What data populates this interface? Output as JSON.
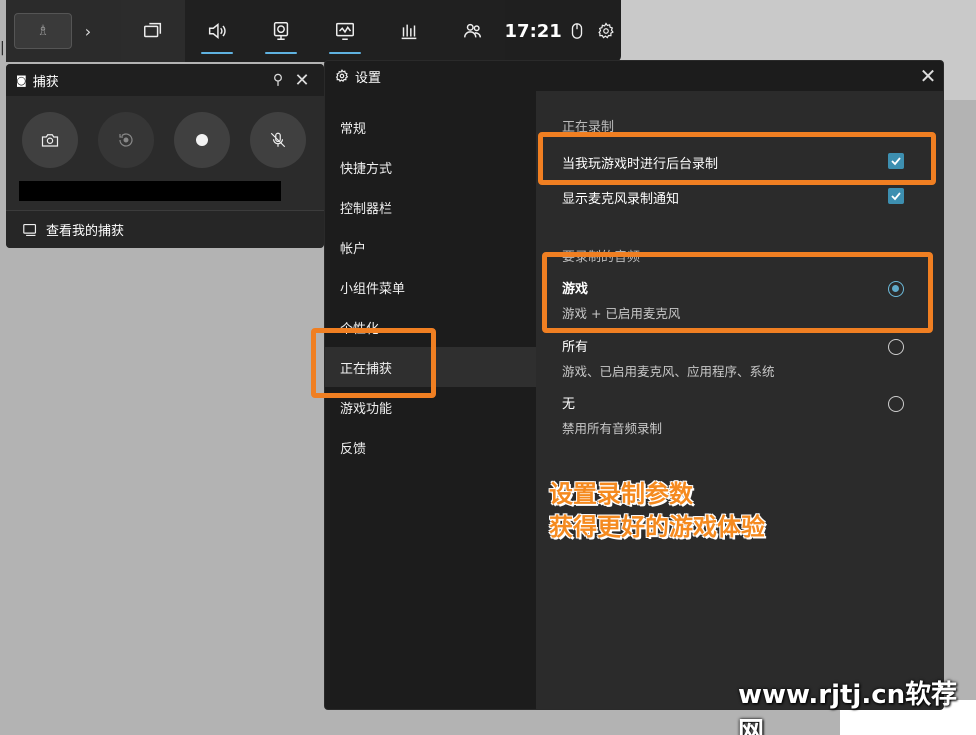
{
  "topbar": {
    "time": "17:21",
    "icons": [
      "widget-menu-icon",
      "audio-icon",
      "capture-icon",
      "performance-icon",
      "resources-icon",
      "xbox-social-icon"
    ]
  },
  "capture_widget": {
    "title": "捕获",
    "view_captures": "查看我的捕获"
  },
  "settings": {
    "title": "设置",
    "nav": [
      {
        "label": "常规"
      },
      {
        "label": "快捷方式"
      },
      {
        "label": "控制器栏"
      },
      {
        "label": "帐户"
      },
      {
        "label": "小组件菜单"
      },
      {
        "label": "个性化"
      },
      {
        "label": "正在捕获"
      },
      {
        "label": "游戏功能"
      },
      {
        "label": "反馈"
      }
    ],
    "recording_section": "正在录制",
    "bg_record": "当我玩游戏时进行后台录制",
    "mic_notify": "显示麦克风录制通知",
    "audio_section": "要录制的音频",
    "audio_options": [
      {
        "label": "游戏",
        "sub": "游戏 + 已启用麦克风",
        "selected": true
      },
      {
        "label": "所有",
        "sub": "游戏、已启用麦克风、应用程序、系统",
        "selected": false
      },
      {
        "label": "无",
        "sub": "禁用所有音频录制",
        "selected": false
      }
    ]
  },
  "annotation": {
    "line1": "设置录制参数",
    "line2": "获得更好的游戏体验",
    "color": "#f07f22"
  },
  "watermark": "www.rjtj.cn软荐网"
}
